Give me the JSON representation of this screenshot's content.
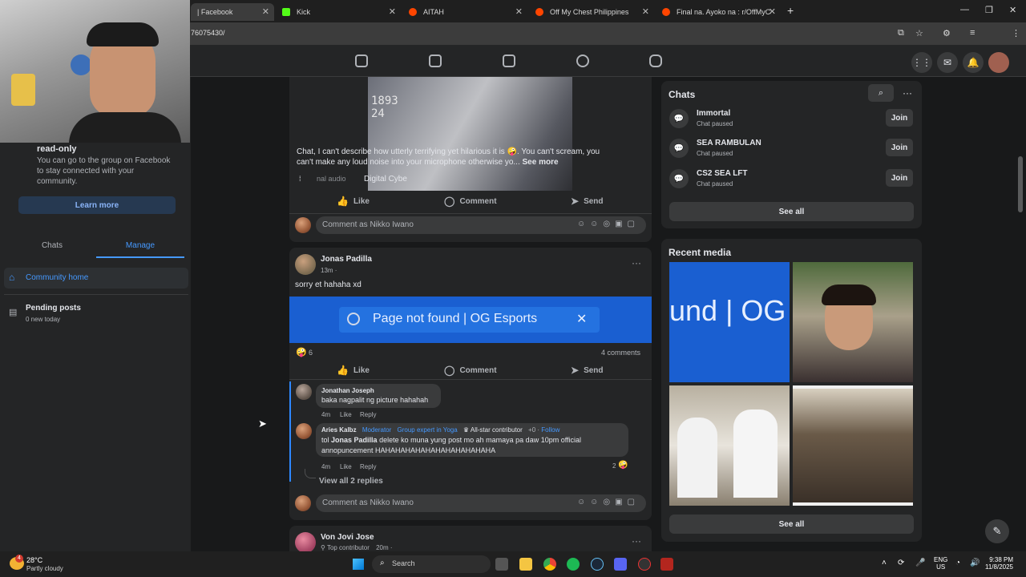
{
  "browser": {
    "tabs": [
      {
        "label": "| Facebook",
        "color": "#1877f2"
      },
      {
        "label": "Kick",
        "color": "#53fc18"
      },
      {
        "label": "AITAH",
        "color": "#ff4500"
      },
      {
        "label": "Off My Chest Philippines",
        "color": "#ff4500"
      },
      {
        "label": "Final na. Ayoko na : r/OffMyChe",
        "color": "#ff4500"
      }
    ],
    "url": "76075430/"
  },
  "sidebar": {
    "readonly_title": "read-only",
    "readonly_desc": "You can go to the group on Facebook to stay connected with your community.",
    "learn_more": "Learn more",
    "tabs": {
      "chats": "Chats",
      "manage": "Manage"
    },
    "community_home": "Community home",
    "pending_posts": "Pending posts",
    "pending_sub": "0 new today"
  },
  "feed": {
    "post1": {
      "text": "Chat, I can't describe how utterly terrifying yet hilarious it is 🤪. You can't scream, you can't make any loud noise into your microphone otherwise yo...",
      "see_more": "See more",
      "audio": "nal audio",
      "audio_by": "Digital Cybe",
      "video_numbers": "1893\n24",
      "like": "Like",
      "comment": "Comment",
      "send": "Send",
      "comment_as": "Comment as Nikko Iwano"
    },
    "post2": {
      "author": "Jonas Padilla",
      "time": "13m ·",
      "text": "sorry et hahaha xd",
      "banner": "Page not found | OG Esports",
      "banner_close": "✕",
      "reactions": "6",
      "comments_count": "4 comments",
      "like": "Like",
      "comment": "Comment",
      "send": "Send",
      "c1_author": "Jonathan Joseph",
      "c1_text": "baka nagpalit ng picture hahahah",
      "c1_time": "4m",
      "c1_like": "Like",
      "c1_reply": "Reply",
      "c2_author": "Aries Kalbz",
      "c2_badge1": "Moderator",
      "c2_badge2": "Group expert in Yoga",
      "c2_badge3": "All-star contributor",
      "c2_badge4": "+0",
      "c2_follow": "Follow",
      "c2_mention": "Jonas Padilla",
      "c2_prefix": "tol",
      "c2_text": "delete ko muna yung post mo ah mamaya pa daw 10pm official annopuncement HAHAHAHAHAHAHAHAHAHAHAHA",
      "c2_time": "4m",
      "c2_like": "Like",
      "c2_reply": "Reply",
      "c2_react": "2",
      "view_replies": "View all 2 replies",
      "comment_as": "Comment as Nikko Iwano"
    },
    "post3": {
      "author": "Von Jovi Jose",
      "badge": "Top contributor",
      "time": "20m ·"
    }
  },
  "right": {
    "chats_title": "Chats",
    "chats": [
      {
        "name": "Immortal",
        "status": "Chat paused",
        "join": "Join"
      },
      {
        "name": "SEA RAMBULAN",
        "status": "Chat paused",
        "join": "Join"
      },
      {
        "name": "CS2 SEA LFT",
        "status": "Chat paused",
        "join": "Join"
      }
    ],
    "see_all": "See all",
    "media_title": "Recent media",
    "media_text": "und | OG",
    "see_all2": "See all"
  },
  "taskbar": {
    "weather_temp": "28°C",
    "weather_desc": "Partly cloudy",
    "weather_badge": "4",
    "search": "Search",
    "lang1": "ENG",
    "lang2": "US",
    "time": "9:38 PM",
    "date": "11/8/2025"
  }
}
